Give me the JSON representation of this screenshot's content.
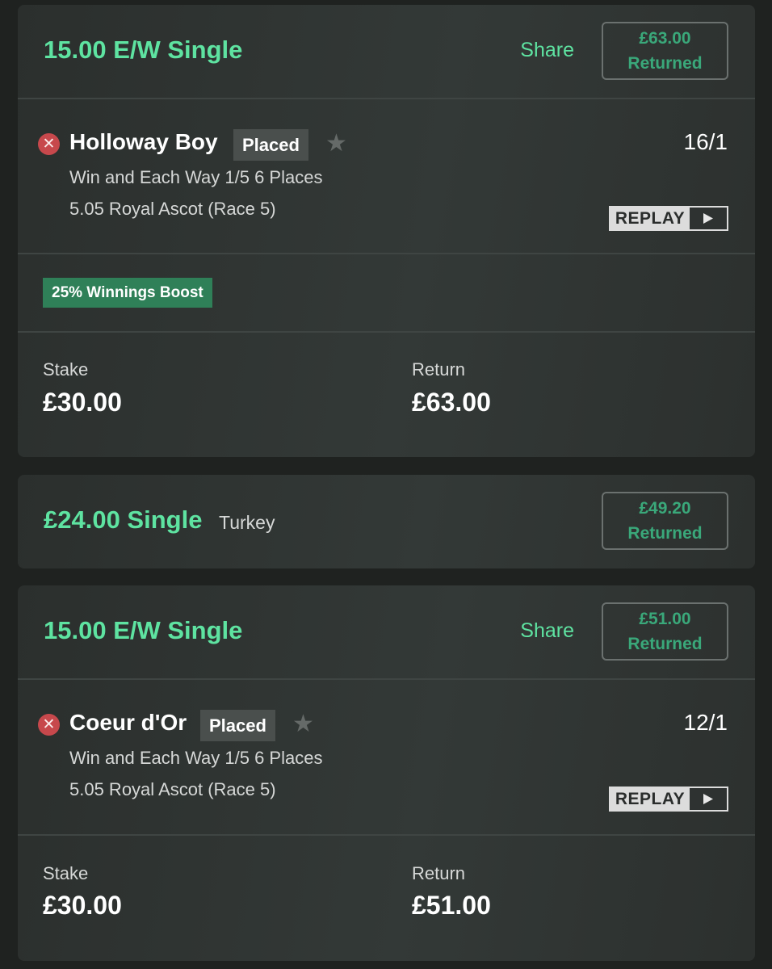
{
  "bets": [
    {
      "title": "15.00 E/W Single",
      "share_label": "Share",
      "returned_amount": "£63.00",
      "returned_label": "Returned",
      "selection": {
        "status_icon": "cross-icon",
        "name": "Holloway Boy",
        "badge": "Placed",
        "odds": "16/1",
        "market": "Win and Each Way 1/5 6 Places",
        "event": "5.05 Royal Ascot (Race 5)",
        "replay_label": "REPLAY"
      },
      "boost_label": "25% Winnings Boost",
      "stake_label": "Stake",
      "stake_value": "£30.00",
      "return_label": "Return",
      "return_value": "£63.00"
    },
    {
      "title": "£24.00 Single",
      "note": "Turkey",
      "returned_amount": "£49.20",
      "returned_label": "Returned"
    },
    {
      "title": "15.00 E/W Single",
      "share_label": "Share",
      "returned_amount": "£51.00",
      "returned_label": "Returned",
      "selection": {
        "status_icon": "cross-icon",
        "name": "Coeur d'Or",
        "badge": "Placed",
        "odds": "12/1",
        "market": "Win and Each Way 1/5 6 Places",
        "event": "5.05 Royal Ascot (Race 5)",
        "replay_label": "REPLAY"
      },
      "stake_label": "Stake",
      "stake_value": "£30.00",
      "return_label": "Return",
      "return_value": "£51.00"
    }
  ],
  "colors": {
    "accent_green": "#5ee3a1",
    "returned_green": "#3aa87a",
    "boost_green": "#2f8058",
    "lost_red": "#c7484c"
  }
}
